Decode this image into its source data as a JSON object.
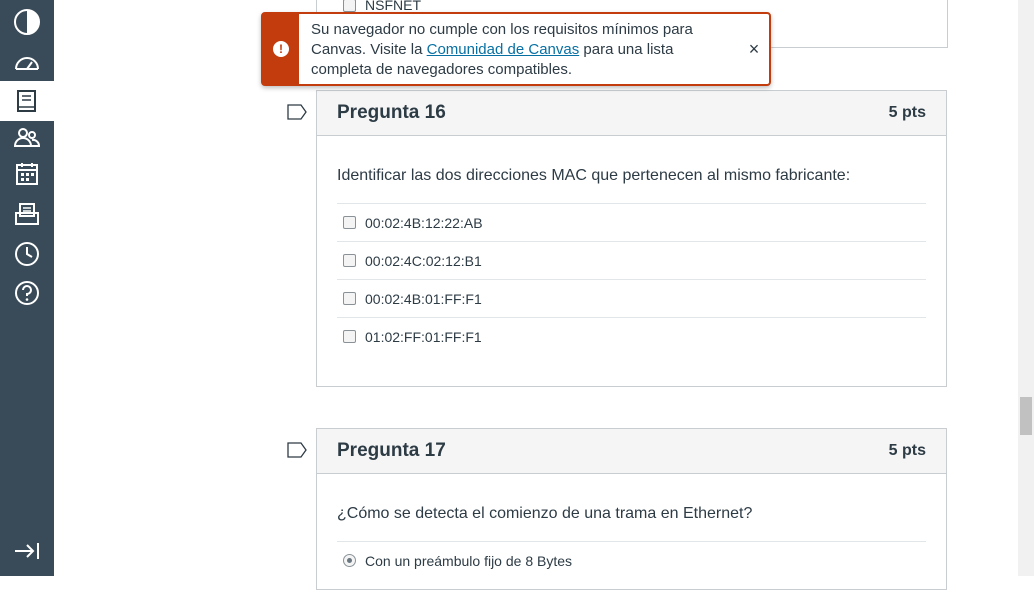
{
  "sidebar": {
    "items": [
      {
        "name": "logo",
        "icon": "canvas-logo-icon"
      },
      {
        "name": "dashboard",
        "icon": "dashboard-icon"
      },
      {
        "name": "courses",
        "icon": "courses-book-icon",
        "active": true
      },
      {
        "name": "groups",
        "icon": "groups-icon"
      },
      {
        "name": "calendar",
        "icon": "calendar-icon"
      },
      {
        "name": "inbox",
        "icon": "inbox-icon"
      },
      {
        "name": "history",
        "icon": "clock-icon"
      },
      {
        "name": "help",
        "icon": "help-icon"
      }
    ],
    "collapse_icon": "collapse-arrow-icon"
  },
  "previous_question": {
    "option_label": "NSFNET"
  },
  "alert": {
    "text_before_link": "Su navegador no cumple con los requisitos mínimos para Canvas. Visite la ",
    "link_text": "Comunidad de Canvas",
    "text_after_link": " para una lista completa de navegadores compatibles.",
    "icon": "warning-icon",
    "close_symbol": "×"
  },
  "questions": [
    {
      "title": "Pregunta 16",
      "points": "5 pts",
      "text": "Identificar las dos direcciones MAC que pertenecen al mismo fabricante:",
      "answers": [
        "00:02:4B:12:22:AB",
        "00:02:4C:02:12:B1",
        "00:02:4B:01:FF:F1",
        "01:02:FF:01:FF:F1"
      ]
    },
    {
      "title": "Pregunta 17",
      "points": "5 pts",
      "text": "¿Cómo se detecta el comienzo de una trama en Ethernet?",
      "answers": [
        "Con un preámbulo fijo de 8 Bytes"
      ]
    }
  ],
  "colors": {
    "sidebar_bg": "#394b58",
    "alert_accent": "#c23c0d",
    "link": "#0770a3"
  }
}
